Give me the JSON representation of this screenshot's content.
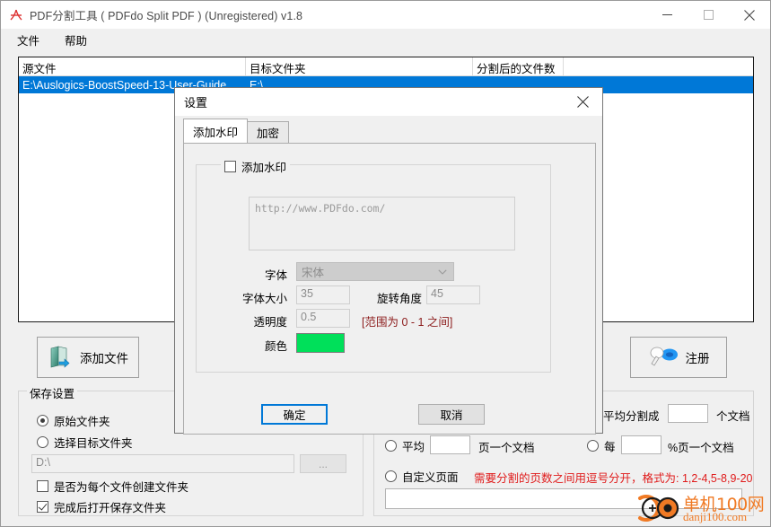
{
  "window": {
    "title": "PDF分割工具 ( PDFdo Split PDF ) (Unregistered) v1.8",
    "icon": "pdf-icon",
    "minimize_label": "—",
    "maximize_label": "□",
    "close_label": "✕"
  },
  "menubar": {
    "items": [
      {
        "label": "文件",
        "name": "menu-file"
      },
      {
        "label": "帮助",
        "name": "menu-help"
      }
    ]
  },
  "filelist": {
    "columns": [
      "源文件",
      "目标文件夹",
      "分割后的文件数",
      ""
    ],
    "rows": [
      {
        "source": "E:\\Auslogics-BoostSpeed-13-User-Guide...",
        "target": "E:\\",
        "count": "",
        "extra": ""
      }
    ]
  },
  "buttons": {
    "add_files": "添加文件",
    "register": "注册"
  },
  "save_settings": {
    "title": "保存设置",
    "radio_original": "原始文件夹",
    "radio_choose": "选择目标文件夹",
    "path_value": "D:\\",
    "browse_label": "...",
    "check_create_folder": "是否为每个文件创建文件夹",
    "check_open_after": "完成后打开保存文件夹",
    "selected_radio": "original",
    "create_folder_checked": false,
    "open_after_checked": true
  },
  "split_settings": {
    "avg_into_prefix": "平均分割成",
    "avg_into_value": "",
    "avg_into_suffix": "个文档",
    "avg_pages_prefix": "平均",
    "avg_pages_value": "",
    "avg_pages_suffix": "页一个文档",
    "percent_prefix": "每",
    "percent_value": "",
    "percent_suffix": "%页一个文档",
    "custom_label": "自定义页面",
    "custom_hint": "需要分割的页数之间用逗号分开，格式为: 1,2-4,5-8,9-20",
    "custom_value": ""
  },
  "dialog": {
    "title": "设置",
    "close_label": "✕",
    "tabs": [
      {
        "label": "添加水印",
        "active": true
      },
      {
        "label": "加密",
        "active": false
      }
    ],
    "watermark": {
      "group_check_label": "添加水印",
      "group_checked": false,
      "text_value": "http://www.PDFdo.com/",
      "font_label": "字体",
      "font_value": "宋体",
      "size_label": "字体大小",
      "size_value": "35",
      "rotation_label": "旋转角度",
      "rotation_value": "45",
      "opacity_label": "透明度",
      "opacity_value": "0.5",
      "opacity_hint": "[范围为 0 - 1 之间]",
      "color_label": "颜色",
      "color_value": "#00e05a"
    },
    "ok_label": "确定",
    "cancel_label": "取消"
  },
  "watermark_overlay": {
    "brand": "单机100网",
    "domain": "danji100.com",
    "color": "#f07a24"
  },
  "colors": {
    "selection": "#0078d7",
    "hint_red": "#e01b1b",
    "hint_darkred": "#8b1a1a"
  }
}
